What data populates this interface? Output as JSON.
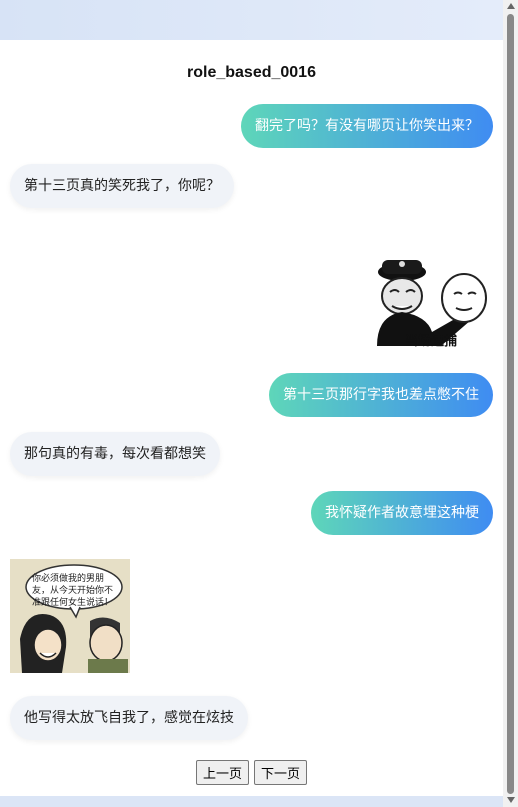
{
  "chat": {
    "title": "role_based_0016",
    "messages": [
      {
        "side": "right",
        "text": "翻完了吗？有没有哪页让你笑出来？"
      },
      {
        "side": "left",
        "text": "第十三页真的笑死我了，你呢？"
      },
      {
        "side": "right",
        "text": "第十三页那行字我也差点憋不住"
      },
      {
        "side": "left",
        "text": "那句真的有毒，每次看都想笑"
      },
      {
        "side": "right",
        "text": "我怀疑作者故意埋这种梗"
      },
      {
        "side": "left",
        "text": "他写得太放飞自我了，感觉在炫技"
      }
    ],
    "sticker1_caption": "当场逮捕",
    "sticker2_caption": "你必须做我的男朋友，从今天开始你不准跟任何女生说话！"
  },
  "pager": {
    "prev": "上一页",
    "next": "下一页"
  }
}
